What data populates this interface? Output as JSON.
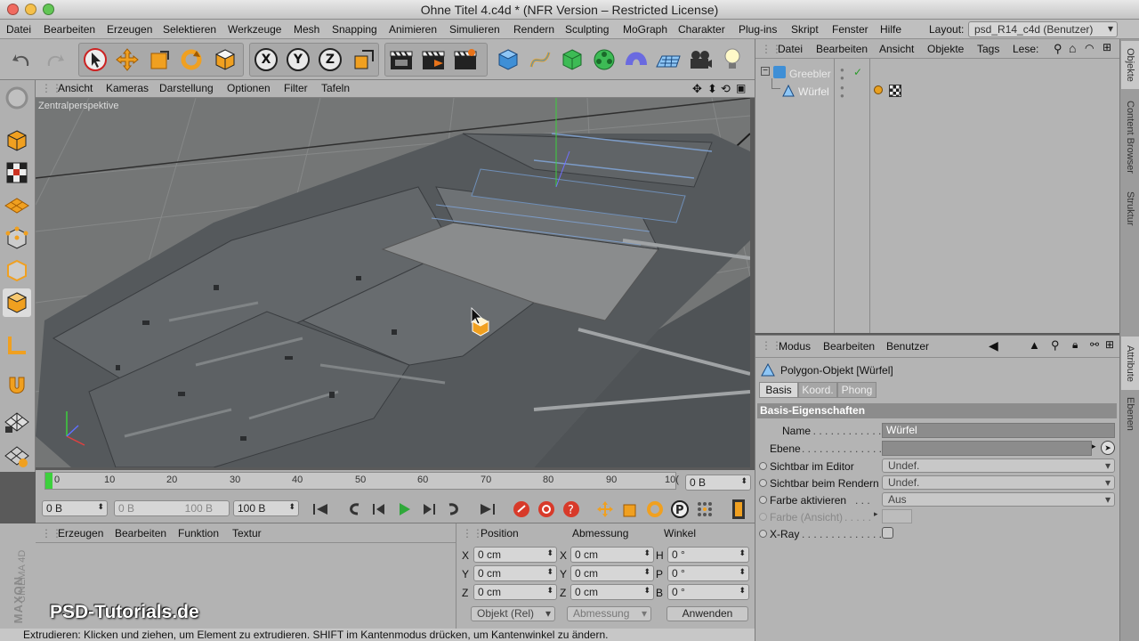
{
  "window": {
    "title": "Ohne Titel 4.c4d * (NFR Version – Restricted License)"
  },
  "menubar": {
    "items": [
      "Datei",
      "Bearbeiten",
      "Erzeugen",
      "Selektieren",
      "Werkzeuge",
      "Mesh",
      "Snapping",
      "Animieren",
      "Simulieren",
      "Rendern",
      "Sculpting",
      "MoGraph",
      "Charakter",
      "Plug-ins",
      "Skript",
      "Fenster",
      "Hilfe"
    ],
    "layout_label": "Layout:",
    "layout_value": "psd_R14_c4d (Benutzer)"
  },
  "viewport": {
    "menu": [
      "Ansicht",
      "Kameras",
      "Darstellung",
      "Optionen",
      "Filter",
      "Tafeln"
    ],
    "label": "Zentralperspektive"
  },
  "timeline": {
    "ticks": [
      "0",
      "10",
      "20",
      "30",
      "40",
      "50",
      "60",
      "70",
      "80",
      "90",
      "10("
    ],
    "current_frame": "0 B"
  },
  "playbar": {
    "start": "0 B",
    "range_start": "0 B",
    "range_end": "100 B",
    "end": "100 B"
  },
  "material": {
    "menu": [
      "Erzeugen",
      "Bearbeiten",
      "Funktion",
      "Textur"
    ]
  },
  "coords": {
    "headers": [
      "Position",
      "Abmessung",
      "Winkel"
    ],
    "rows": [
      {
        "a": "X",
        "pos": "0 cm",
        "b": "X",
        "size": "0 cm",
        "c": "H",
        "angle": "0 °"
      },
      {
        "a": "Y",
        "pos": "0 cm",
        "b": "Y",
        "size": "0 cm",
        "c": "P",
        "angle": "0 °"
      },
      {
        "a": "Z",
        "pos": "0 cm",
        "b": "Z",
        "size": "0 cm",
        "c": "B",
        "angle": "0 °"
      }
    ],
    "mode": "Objekt (Rel)",
    "size_mode": "Abmessung",
    "apply": "Anwenden"
  },
  "status": "Extrudieren: Klicken und ziehen, um Element zu extrudieren. SHIFT im Kantenmodus drücken, um Kantenwinkel zu ändern.",
  "brand": {
    "maxon": "MAXON",
    "cinema": "CINEMA 4D",
    "watermark": "PSD-Tutorials.de"
  },
  "objects": {
    "menu": [
      "Datei",
      "Bearbeiten",
      "Ansicht",
      "Objekte",
      "Tags",
      "Lese:"
    ],
    "items": [
      {
        "name": "Greebler"
      },
      {
        "name": "Würfel"
      }
    ]
  },
  "attributes": {
    "menu": [
      "Modus",
      "Bearbeiten",
      "Benutzer"
    ],
    "object_title": "Polygon-Objekt [Würfel]",
    "tabs": [
      "Basis",
      "Koord.",
      "Phong"
    ],
    "section": "Basis-Eigenschaften",
    "name_label": "Name",
    "name_value": "Würfel",
    "layer_label": "Ebene",
    "vis_editor_label": "Sichtbar im Editor",
    "vis_editor_value": "Undef.",
    "vis_render_label": "Sichtbar beim Rendern",
    "vis_render_value": "Undef.",
    "color_label": "Farbe aktivieren",
    "color_value": "Aus",
    "display_color_label": "Farbe (Ansicht)",
    "xray_label": "X-Ray"
  },
  "right_tabs": [
    "Objekte",
    "Content Browser",
    "Struktur",
    "Attribute",
    "Ebenen"
  ],
  "colors": {
    "accent": "#e8a02a",
    "selection": "#5d7fb8",
    "tab_active": "#d8d8d8"
  }
}
